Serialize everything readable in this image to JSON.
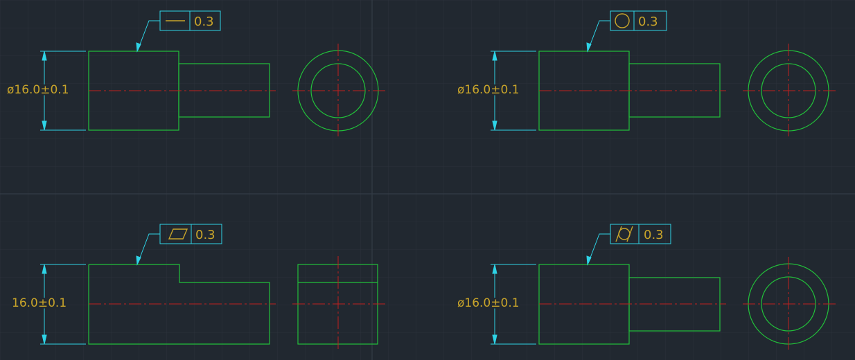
{
  "colors": {
    "background": "#212830",
    "grid_minor": "#2a313a",
    "grid_major": "#343c46",
    "geometry": "#22c03a",
    "centerline": "#c0201e",
    "dimension": "#2ed3e6",
    "text": "#c8a42a"
  },
  "views": [
    {
      "id": "straightness",
      "tolerance_symbol": "straightness-icon",
      "tolerance_value": "0.3",
      "dimension_text": "ø16.0±0.1"
    },
    {
      "id": "circularity",
      "tolerance_symbol": "circularity-icon",
      "tolerance_value": "0.3",
      "dimension_text": "ø16.0±0.1"
    },
    {
      "id": "flatness",
      "tolerance_symbol": "flatness-icon",
      "tolerance_value": "0.3",
      "dimension_text": "16.0±0.1"
    },
    {
      "id": "cylindricity",
      "tolerance_symbol": "cylindricity-icon",
      "tolerance_value": "0.3",
      "dimension_text": "ø16.0±0.1"
    }
  ]
}
